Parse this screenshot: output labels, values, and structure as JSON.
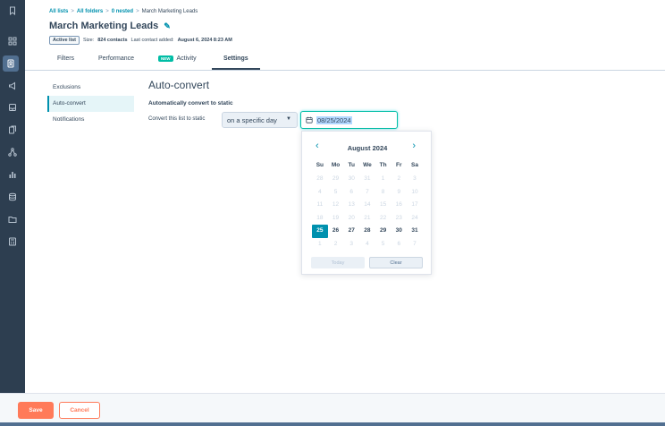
{
  "rail": {
    "icons": [
      "bookmark-icon",
      "grid-icon",
      "contacts-icon",
      "megaphone-icon",
      "inbox-icon",
      "documents-icon",
      "workflows-icon",
      "reports-icon",
      "database-icon",
      "folder-icon",
      "calculator-icon"
    ]
  },
  "breadcrumb": {
    "items": [
      "All lists",
      "All folders",
      "0 nested"
    ],
    "separator": ">",
    "current": "March Marketing Leads"
  },
  "page": {
    "title": "March Marketing Leads",
    "list_type": "Active list",
    "size_label": "Size:",
    "size_value": "824 contacts",
    "last_added_label": "Last contact added:",
    "last_added_value": "August 6, 2024 8:23 AM"
  },
  "tabs": {
    "filters": "Filters",
    "performance": "Performance",
    "new_badge": "NEW",
    "activity": "Activity",
    "settings": "Settings"
  },
  "subnav": {
    "exclusions": "Exclusions",
    "auto_convert": "Auto-convert",
    "notifications": "Notifications"
  },
  "main": {
    "heading": "Auto-convert",
    "subheading": "Automatically convert to static",
    "convert_label": "Convert this list to static",
    "dropdown_value": "on a specific day",
    "date_value": "08/25/2024"
  },
  "calendar": {
    "prev": "‹",
    "next": "›",
    "month_label": "August 2024",
    "weekdays": [
      "Su",
      "Mo",
      "Tu",
      "We",
      "Th",
      "Fr",
      "Sa"
    ],
    "weeks": [
      [
        "28",
        "29",
        "30",
        "31",
        "1",
        "2",
        "3"
      ],
      [
        "4",
        "5",
        "6",
        "7",
        "8",
        "9",
        "10"
      ],
      [
        "11",
        "12",
        "13",
        "14",
        "15",
        "16",
        "17"
      ],
      [
        "18",
        "19",
        "20",
        "21",
        "22",
        "23",
        "24"
      ],
      [
        "25",
        "26",
        "27",
        "28",
        "29",
        "30",
        "31"
      ],
      [
        "1",
        "2",
        "3",
        "4",
        "5",
        "6",
        "7"
      ]
    ],
    "selected": "25",
    "today_label": "Today",
    "clear_label": "Clear"
  },
  "footer": {
    "save_label": "Save",
    "cancel_label": "Cancel"
  },
  "colors": {
    "accent": "#0091ae",
    "primary_button": "#ff7a59",
    "rail": "#2d3e50",
    "text": "#33475b"
  }
}
